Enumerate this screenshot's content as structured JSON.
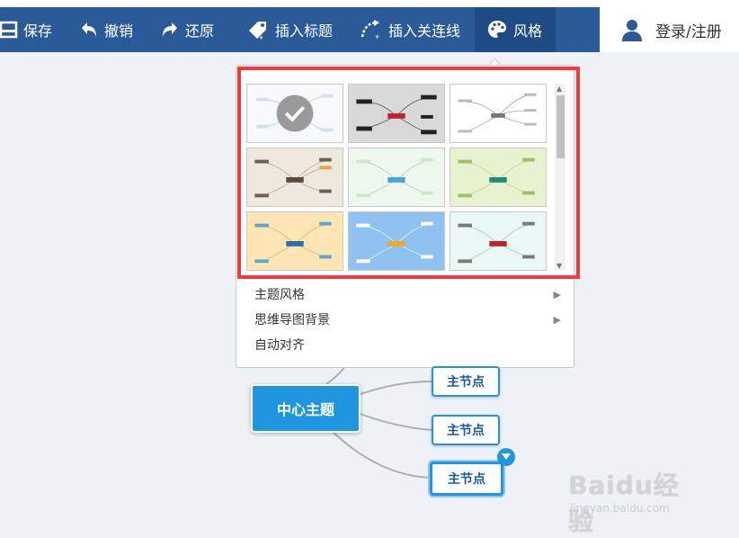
{
  "toolbar": {
    "save": "保存",
    "undo": "撤销",
    "redo": "还原",
    "insert_title": "插入标题",
    "insert_link": "插入关连线",
    "style": "风格",
    "login": "登录/注册"
  },
  "style_menu": {
    "items": [
      {
        "label": "主题风格"
      },
      {
        "label": "思维导图背景"
      },
      {
        "label": "自动对齐"
      }
    ]
  },
  "mindmap": {
    "center": "中心主题",
    "main_nodes": [
      {
        "label": "主节点"
      },
      {
        "label": "主节点"
      },
      {
        "label": "主节点"
      }
    ]
  },
  "watermark": {
    "logo": "Baidu经验",
    "sub": "jingyan.baidu.com"
  },
  "colors": {
    "toolbar": "#2b5a98",
    "accent": "#2196e0",
    "highlight": "#f03a3f"
  }
}
